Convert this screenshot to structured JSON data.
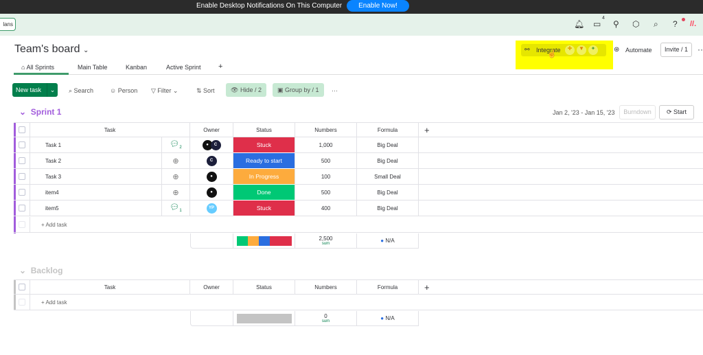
{
  "banner": {
    "text": "Enable Desktop Notifications On This Computer",
    "button": "Enable Now!"
  },
  "topbar": {
    "plans": "lans",
    "inbox_count": "4"
  },
  "board": {
    "title": "Team's board",
    "integrate": "Integrate",
    "automate": "Automate",
    "invite": "Invite / 1"
  },
  "tabs": [
    "All Sprints",
    "Main Table",
    "Kanban",
    "Active Sprint",
    "+"
  ],
  "toolbar": {
    "new_task": "New task",
    "search": "Search",
    "person": "Person",
    "filter": "Filter",
    "sort": "Sort",
    "hide": "Hide / 2",
    "group_by": "Group by / 1",
    "more": "···"
  },
  "columns": [
    "Task",
    "Owner",
    "Status",
    "Numbers",
    "Formula",
    "+"
  ],
  "colors": {
    "stuck": "#df2f4a",
    "ready": "#2a6ee0",
    "progress": "#fdab3d",
    "done": "#00c875",
    "sprint": "#a25ddc",
    "backlog": "#c4c4c4"
  },
  "sprint1": {
    "name": "Sprint 1",
    "dates": "Jan 2, '23 - Jan 15, '23",
    "burndown": "Burndown",
    "start": "Start",
    "rows": [
      {
        "task": "Task 1",
        "comments": "2",
        "owner": "C",
        "status": "Stuck",
        "status_color": "#df2f4a",
        "number": "1,000",
        "formula": "Big Deal"
      },
      {
        "task": "Task 2",
        "comments": "",
        "owner": "C",
        "status": "Ready to start",
        "status_color": "#2a6ee0",
        "number": "500",
        "formula": "Big Deal"
      },
      {
        "task": "Task 3",
        "comments": "",
        "owner": "",
        "status": "In Progress",
        "status_color": "#fdab3d",
        "number": "100",
        "formula": "Small Deal"
      },
      {
        "task": "item4",
        "comments": "",
        "owner": "",
        "status": "Done",
        "status_color": "#00c875",
        "number": "500",
        "formula": "Big Deal"
      },
      {
        "task": "item5",
        "comments": "1",
        "owner": "YP",
        "status": "Stuck",
        "status_color": "#df2f4a",
        "number": "400",
        "formula": "Big Deal"
      }
    ],
    "add_task": "+ Add task",
    "sum": "2,500",
    "sum_label": "sum",
    "formula_sum": "N/A"
  },
  "backlog": {
    "name": "Backlog",
    "add_task": "+ Add task",
    "sum": "0",
    "sum_label": "sum",
    "formula_sum": "N/A"
  }
}
